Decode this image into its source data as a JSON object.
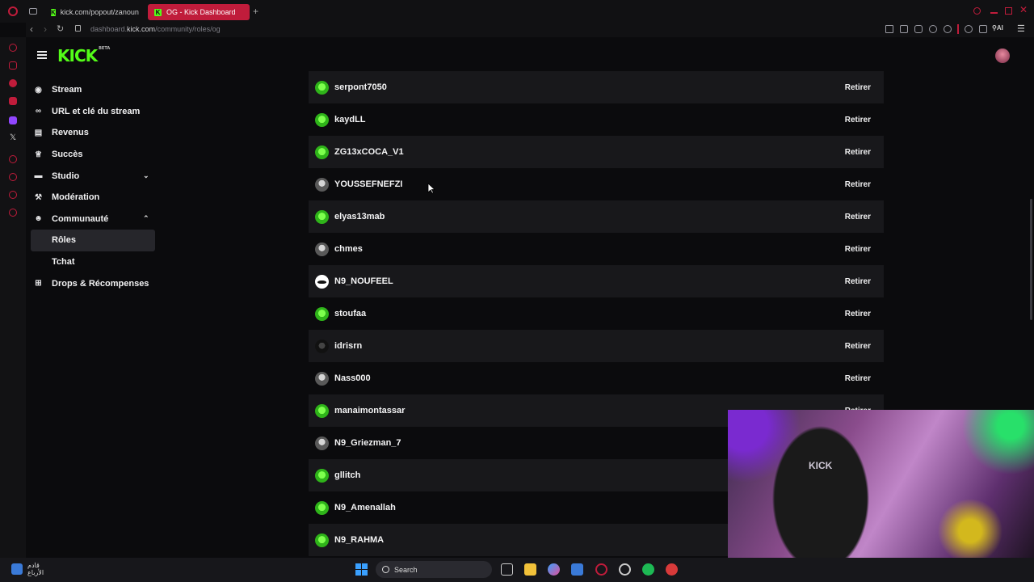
{
  "browser": {
    "tabs": [
      {
        "title": "kick.com/popout/zanoun",
        "active": false
      },
      {
        "title": "OG - Kick Dashboard",
        "active": true
      }
    ],
    "url_host": "dashboard.",
    "url_domain": "kick.com",
    "url_path": "/community/roles/og"
  },
  "header": {
    "logo": "KICK",
    "logo_badge": "BETA"
  },
  "sidebar": {
    "items": [
      {
        "label": "Stream",
        "icon": "signal-icon"
      },
      {
        "label": "URL et clé du stream",
        "icon": "link-icon"
      },
      {
        "label": "Revenus",
        "icon": "chart-icon"
      },
      {
        "label": "Succès",
        "icon": "trophy-icon"
      },
      {
        "label": "Studio",
        "icon": "studio-icon",
        "chevron": "down"
      },
      {
        "label": "Modération",
        "icon": "gavel-icon"
      },
      {
        "label": "Communauté",
        "icon": "community-icon",
        "chevron": "up"
      },
      {
        "label": "Rôles",
        "sub": true,
        "selected": true
      },
      {
        "label": "Tchat",
        "sub": true
      },
      {
        "label": "Drops & Récompenses",
        "icon": "gift-icon"
      }
    ]
  },
  "members": {
    "remove_label": "Retirer",
    "rows": [
      {
        "username": "serpont7050",
        "avatar": "green"
      },
      {
        "username": "kaydLL",
        "avatar": "green"
      },
      {
        "username": "ZG13xCOCA_V1",
        "avatar": "green"
      },
      {
        "username": "YOUSSEFNEFZI",
        "avatar": "grey"
      },
      {
        "username": "elyas13mab",
        "avatar": "green"
      },
      {
        "username": "chmes",
        "avatar": "grey"
      },
      {
        "username": "N9_NOUFEEL",
        "avatar": "mustache"
      },
      {
        "username": "stoufaa",
        "avatar": "green"
      },
      {
        "username": "idrisrn",
        "avatar": "dark"
      },
      {
        "username": "Nass000",
        "avatar": "grey"
      },
      {
        "username": "manaimontassar",
        "avatar": "green"
      },
      {
        "username": "N9_Griezman_7",
        "avatar": "grey"
      },
      {
        "username": "gllitch",
        "avatar": "green"
      },
      {
        "username": "N9_Amenallah",
        "avatar": "green"
      },
      {
        "username": "N9_RAHMA",
        "avatar": "green"
      }
    ]
  },
  "webcam": {
    "sign": "KICK"
  },
  "taskbar": {
    "weather_line1": "قادم",
    "weather_line2": "الأرباع",
    "search_label": "Search"
  }
}
